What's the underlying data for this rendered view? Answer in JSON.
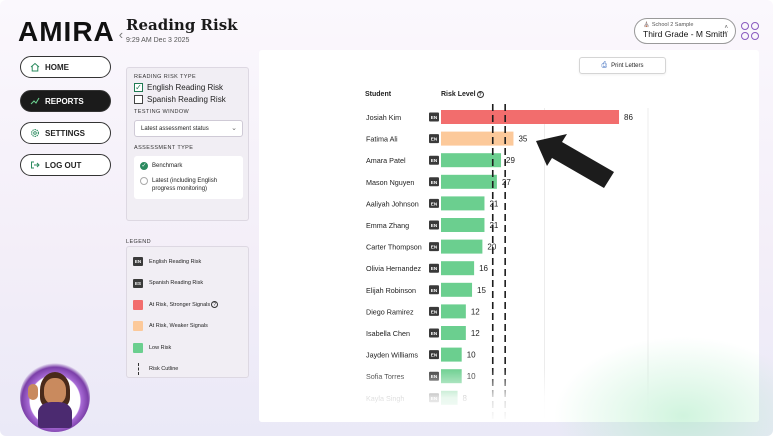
{
  "brand": {
    "logo": "AMIRA"
  },
  "header": {
    "title": "Reading Risk",
    "timestamp": "9:29 AM Dec 3 2025",
    "school": "School 2 Sample",
    "class_label": "Third Grade - M Smith"
  },
  "nav": [
    {
      "label": "HOME",
      "icon": "home-icon"
    },
    {
      "label": "REPORTS",
      "icon": "reports-icon",
      "active": true
    },
    {
      "label": "SETTINGS",
      "icon": "gear-icon"
    },
    {
      "label": "LOG OUT",
      "icon": "logout-icon"
    }
  ],
  "filters": {
    "reading_risk_type_label": "READING RISK TYPE",
    "english_option": "English Reading Risk",
    "spanish_option": "Spanish Reading Risk",
    "english_checked": true,
    "spanish_checked": false,
    "testing_window_label": "TESTING WINDOW",
    "testing_window_value": "Latest assessment status",
    "assessment_type_label": "ASSESSMENT TYPE",
    "benchmark_option": "Benchmark",
    "latest_option": "Latest (including English progress monitoring)",
    "selected_assessment": "Benchmark"
  },
  "legend": {
    "title": "LEGEND",
    "items": [
      {
        "badge": "EN",
        "label": "English Reading Risk"
      },
      {
        "badge": "ES",
        "label": "Spanish Reading Risk"
      },
      {
        "swatch": "#f26d6d",
        "label": "At Risk, Stronger Signals"
      },
      {
        "swatch": "#fcc99a",
        "label": "At Risk, Weaker Signals"
      },
      {
        "swatch": "#6bcf8f",
        "label": "Low Risk"
      },
      {
        "cutline": true,
        "label": "Risk Cutline"
      }
    ]
  },
  "main": {
    "print_label": "Print Letters",
    "col_student": "Student",
    "col_risk": "Risk Level"
  },
  "colors": {
    "stronger": "#f26d6d",
    "weaker": "#fcc99a",
    "low": "#6bcf8f",
    "badge": "#3a3a3a",
    "arrow": "#1c1c1c"
  },
  "chart_data": {
    "type": "bar",
    "orientation": "horizontal",
    "title": "",
    "xlabel": "Risk Level",
    "ylabel": "Student",
    "xlim": [
      0,
      100
    ],
    "cutlines": [
      25,
      31
    ],
    "rows": [
      {
        "name": "Josiah Kim",
        "lang": "EN",
        "value": 86,
        "status": "stronger"
      },
      {
        "name": "Fatima Ali",
        "lang": "EN",
        "value": 35,
        "status": "weaker"
      },
      {
        "name": "Amara Patel",
        "lang": "EN",
        "value": 29,
        "status": "low"
      },
      {
        "name": "Mason Nguyen",
        "lang": "EN",
        "value": 27,
        "status": "low"
      },
      {
        "name": "Aaliyah Johnson",
        "lang": "EN",
        "value": 21,
        "status": "low"
      },
      {
        "name": "Emma Zhang",
        "lang": "EN",
        "value": 21,
        "status": "low"
      },
      {
        "name": "Carter Thompson",
        "lang": "EN",
        "value": 20,
        "status": "low"
      },
      {
        "name": "Olivia Hernandez",
        "lang": "EN",
        "value": 16,
        "status": "low"
      },
      {
        "name": "Elijah Robinson",
        "lang": "EN",
        "value": 15,
        "status": "low"
      },
      {
        "name": "Diego Ramirez",
        "lang": "EN",
        "value": 12,
        "status": "low"
      },
      {
        "name": "Isabella Chen",
        "lang": "EN",
        "value": 12,
        "status": "low"
      },
      {
        "name": "Jayden Williams",
        "lang": "EN",
        "value": 10,
        "status": "low"
      },
      {
        "name": "Sofia Torres",
        "lang": "EN",
        "value": 10,
        "status": "low"
      },
      {
        "name": "Kayla Singh",
        "lang": "EN",
        "value": 8,
        "status": "low"
      }
    ]
  }
}
